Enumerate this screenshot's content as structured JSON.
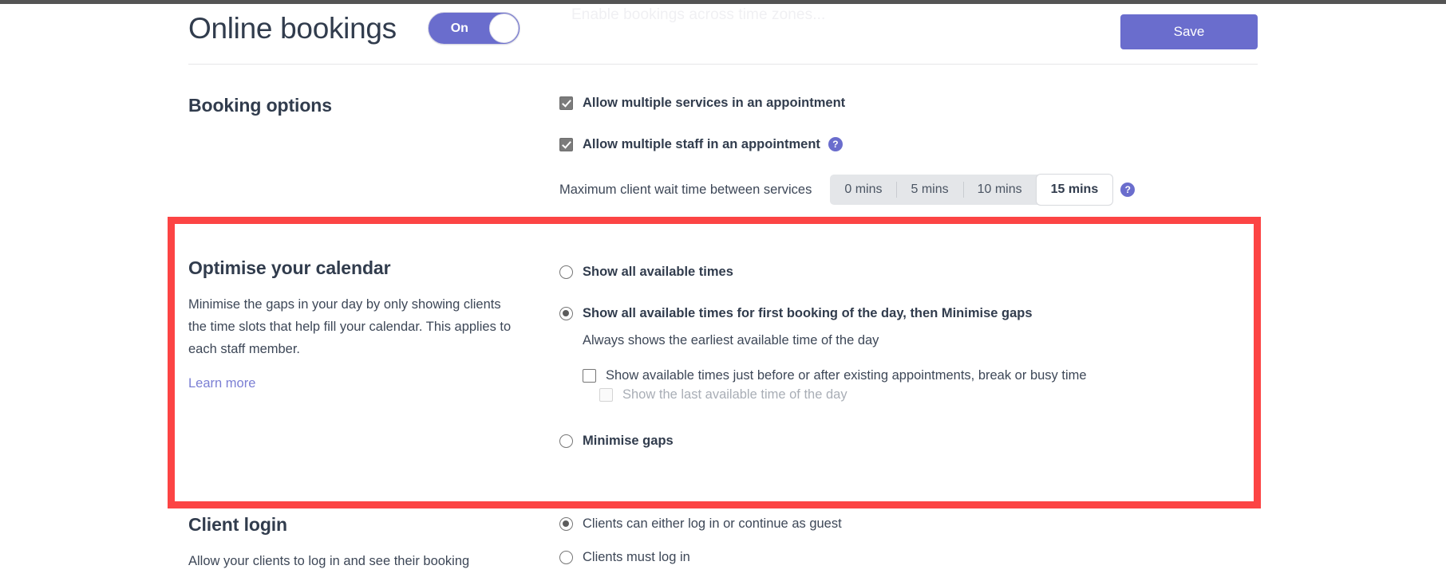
{
  "header": {
    "title": "Online bookings",
    "toggle": {
      "state_label": "On",
      "on": true
    },
    "ghost_text": "Enable bookings across time zones...",
    "save_label": "Save"
  },
  "booking_options": {
    "heading": "Booking options",
    "checkboxes": [
      {
        "label": "Allow multiple services in an appointment",
        "checked": true,
        "help": false
      },
      {
        "label": "Allow multiple staff in an appointment",
        "checked": true,
        "help": true
      }
    ],
    "wait_time": {
      "label": "Maximum client wait time between services",
      "options": [
        "0 mins",
        "5 mins",
        "10 mins",
        "15 mins"
      ],
      "selected": "15 mins",
      "help": true
    }
  },
  "optimise": {
    "heading": "Optimise your calendar",
    "description": "Minimise the gaps in your day by only showing clients the time slots that help fill your calendar. This applies to each staff member.",
    "learn_more": "Learn more",
    "radio_1": {
      "label": "Show all available times",
      "selected": false
    },
    "radio_2": {
      "label": "Show all available times for first booking of the day, then Minimise gaps",
      "selected": true,
      "sub_text": "Always shows the earliest available time of the day"
    },
    "nested_checkbox_1": {
      "label": "Show available times just before or after existing appointments, break or busy time",
      "checked": false,
      "disabled": false
    },
    "nested_checkbox_2": {
      "label": "Show the last available time of the day",
      "checked": false,
      "disabled": true
    },
    "radio_3": {
      "label": "Minimise gaps",
      "selected": false
    }
  },
  "client_login": {
    "heading": "Client login",
    "description": "Allow your clients to log in and see their booking",
    "radio_1": {
      "label": "Clients can either log in or continue as guest",
      "selected": true
    },
    "radio_2": {
      "label": "Clients must log in",
      "selected": false
    }
  },
  "icons": {
    "help": "?",
    "check": "check-icon"
  },
  "colors": {
    "accent": "#6a6dcd",
    "highlight": "#fc4444",
    "heading": "#313c4d",
    "link": "#7b7fd4"
  }
}
